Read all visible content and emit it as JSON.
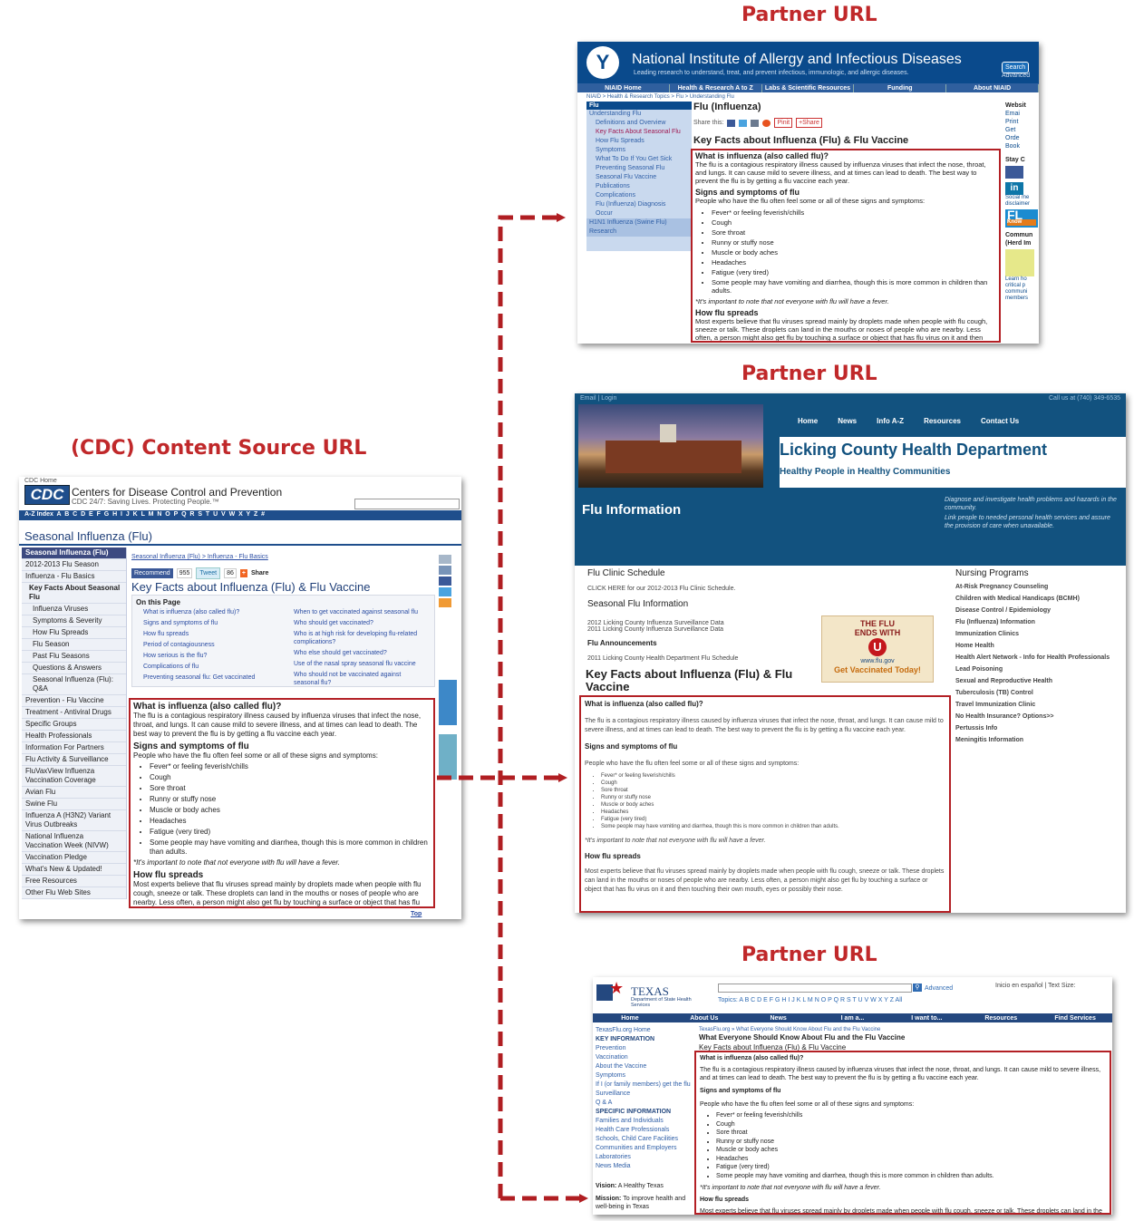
{
  "headings": {
    "partner": "Partner URL",
    "source": "(CDC) Content Source URL"
  },
  "colors": {
    "heading": "#c0282a",
    "arrow": "#b01e22",
    "cdc_blue": "#1f4e8c",
    "niaid_blue": "#0a4a8c",
    "licking_blue": "#12527f",
    "texas_blue": "#24487f"
  },
  "article": {
    "q_title": "What is influenza (also called flu)?",
    "q_text": "The flu is a contagious respiratory illness caused by influenza viruses that infect the nose, throat, and lungs. It can cause mild to severe illness, and at times can lead to death. The best way to prevent the flu is by getting a flu vaccine each year.",
    "signs_title": "Signs and symptoms of flu",
    "signs_intro": "People who have the flu often feel some or all of these signs and symptoms:",
    "symptoms": [
      "Fever* or feeling feverish/chills",
      "Cough",
      "Sore throat",
      "Runny or stuffy nose",
      "Muscle or body aches",
      "Headaches",
      "Fatigue (very tired)",
      "Some people may have vomiting and diarrhea, though this is more common in children than adults."
    ],
    "note": "*It's important to note that not everyone with flu will have a fever.",
    "spread_title": "How flu spreads",
    "spread_text": "Most experts believe that flu viruses spread mainly by droplets made when people with flu cough, sneeze or talk. These droplets can land in the mouths or noses of people who are nearby. Less often, a person might also get flu by touching a surface or object that has flu virus on it and then touching their own mouth, eyes or possibly their nose."
  },
  "cdc": {
    "home": "CDC Home",
    "logo": "CDC",
    "name": "Centers for Disease Control and Prevention",
    "tagline": "CDC 24/7: Saving Lives. Protecting People.™",
    "az": "A-Z Index  A  B  C  D  E  F  G  H  I  J  K  L  M  N  O  P  Q  R  S  T  U  V  W  X  Y  Z  #",
    "title": "Seasonal Influenza (Flu)",
    "nav": [
      "Seasonal Influenza (Flu)",
      "2012-2013 Flu Season",
      "Influenza - Flu Basics",
      "Key Facts About Seasonal Flu",
      "Influenza Viruses",
      "Symptoms & Severity",
      "How Flu Spreads",
      "Flu Season",
      "Past Flu Seasons",
      "Questions & Answers",
      "Seasonal Influenza (Flu): Q&A",
      "Prevention - Flu Vaccine",
      "Treatment - Antiviral Drugs",
      "Specific Groups",
      "Health Professionals",
      "Information For Partners",
      "Flu Activity & Surveillance",
      "FluVaxView Influenza Vaccination Coverage",
      "Avian Flu",
      "Swine Flu",
      "Influenza A (H3N2) Variant Virus Outbreaks",
      "National Influenza Vaccination Week (NIVW)",
      "Vaccination Pledge",
      "What's New & Updated!",
      "Free Resources",
      "Other Flu Web Sites"
    ],
    "breadcrumb": "Seasonal Influenza (Flu) > Influenza - Flu Basics",
    "recommend": "Recommend",
    "recommend_count": "955",
    "tweet": "Tweet",
    "tweet_count": "86",
    "share": "Share",
    "page_title": "Key Facts about Influenza (Flu) & Flu Vaccine",
    "on_this_page": "On this Page",
    "links_left": [
      "What is influenza (also called flu)?",
      "Signs and symptoms of flu",
      "How flu spreads",
      "Period of contagiousness",
      "How serious is the flu?",
      "Complications of flu",
      "Preventing seasonal flu: Get vaccinated"
    ],
    "links_right": [
      "When to get vaccinated against seasonal flu",
      "Who should get vaccinated?",
      "Who is at high risk for developing flu-related complications?",
      "Who else should get vaccinated?",
      "Use of the nasal spray seasonal flu vaccine",
      "Who should not be vaccinated against seasonal flu?"
    ],
    "top": "Top"
  },
  "niaid": {
    "title": "National Institute of Allergy and Infectious Diseases",
    "subtitle": "Leading research to understand, treat, and prevent infectious, immunologic, and allergic diseases.",
    "search": "Search",
    "advanced": "Advanced",
    "menu": [
      "NIAID Home",
      "Health & Research A to Z",
      "Labs & Scientific Resources",
      "Funding",
      "About NIAID"
    ],
    "breadcrumb": "NIAID > Health & Research Topics > Flu > Understanding Flu",
    "nav_head": "Flu",
    "nav": [
      "Understanding Flu",
      "Definitions and Overview",
      "Key Facts About Seasonal Flu",
      "How Flu Spreads",
      "Symptoms",
      "What To Do If You Get Sick",
      "Preventing Seasonal Flu",
      "Seasonal Flu Vaccine",
      "Publications",
      "Complications",
      "Flu (Influenza) Diagnosis",
      "Occur",
      "H1N1 Influenza (Swine Flu)",
      "Research"
    ],
    "page_title": "Flu (Influenza)",
    "share_this": "Share this:",
    "pinit": "Pinit",
    "plus_share": "+Share",
    "article_title": "Key Facts about Influenza (Flu) & Flu Vaccine",
    "side": [
      "Websit",
      "Emai",
      "Print",
      "Get",
      "Orde",
      "Book"
    ],
    "stay": "Stay C",
    "fl": "FL",
    "know": "Know",
    "commun": "Commun (Herd Im",
    "learn": "Learn ho critical p communi members",
    "social": "Social me disclaimer"
  },
  "licking": {
    "top_left": "Email | Login",
    "top_right": "Call us at (740) 349-6535",
    "menu": [
      "Home",
      "News",
      "Info A-Z",
      "Resources",
      "Contact Us"
    ],
    "name": "Licking County Health Department",
    "tagline": "Healthy People in Healthy Communities",
    "banner_title": "Flu Information",
    "banner_text1": "Diagnose and investigate health problems and hazards in the community.",
    "banner_text2": "Link people to needed personal health services and assure the provision of care when unavailable.",
    "clinic": "Flu Clinic Schedule",
    "click_here": "CLICK HERE for our 2012-2013 Flu Clinic Schedule.",
    "seasonal": "Seasonal Flu Information",
    "surv1": "2012 Licking County Influenza Surveillance Data",
    "surv2": "2011 Licking County Influenza Surveillance Data",
    "announce": "Flu Announcements",
    "schedule": "2011 Licking County Health Department Flu Schedule",
    "ad_line1": "THE FLU",
    "ad_line2": "ENDS WITH",
    "ad_letter": "U",
    "ad_url": "www.flu.gov",
    "ad_cta": "Get Vaccinated Today!",
    "page_title": "Key Facts about Influenza (Flu) & Flu Vaccine",
    "nursing_title": "Nursing Programs",
    "nursing": [
      "At-Risk Pregnancy Counseling",
      "Children with Medical Handicaps (BCMH)",
      "Disease Control / Epidemiology",
      "Flu (Influenza) Information",
      "Immunization Clinics",
      "Home Health",
      "Health Alert Network - Info for Health Professionals",
      "Lead Poisoning",
      "Sexual and Reproductive Health",
      "Tuberculosis (TB) Control",
      "Travel Immunization Clinic",
      "No Health Insurance? Options>>",
      "Pertussis Info",
      "Meningitis Information"
    ]
  },
  "texas": {
    "logo": "TEXAS",
    "dept": "Department of State Health Services",
    "advanced": "Advanced",
    "topics": "Topics: A B C D E F G H I J K L M N O P Q R S T U V W X Y Z All",
    "util": "Inicio en español | Text Size:",
    "menu": [
      "Home",
      "About Us",
      "News",
      "I am a...",
      "I want to...",
      "Resources",
      "Find Services"
    ],
    "nav": [
      "TexasFlu.org Home",
      "KEY INFORMATION",
      "Prevention",
      "Vaccination",
      "About the Vaccine",
      "Symptoms",
      "If I (or family members) get the flu",
      "Surveillance",
      "Q & A",
      "SPECIFIC INFORMATION",
      "Families and Individuals",
      "Health Care Professionals",
      "Schools, Child Care Facilities",
      "Communities and Employers",
      "Laboratories",
      "News Media"
    ],
    "vision_label": "Vision:",
    "vision": "A Healthy Texas",
    "mission_label": "Mission:",
    "mission": "To improve health and well-being in Texas",
    "breadcrumb": "TexasFlu.org » What Everyone Should Know About Flu and the Flu Vaccine",
    "page_title": "What Everyone Should Know About Flu and the Flu Vaccine",
    "subtitle": "Key Facts about Influenza (Flu) & Flu Vaccine"
  }
}
